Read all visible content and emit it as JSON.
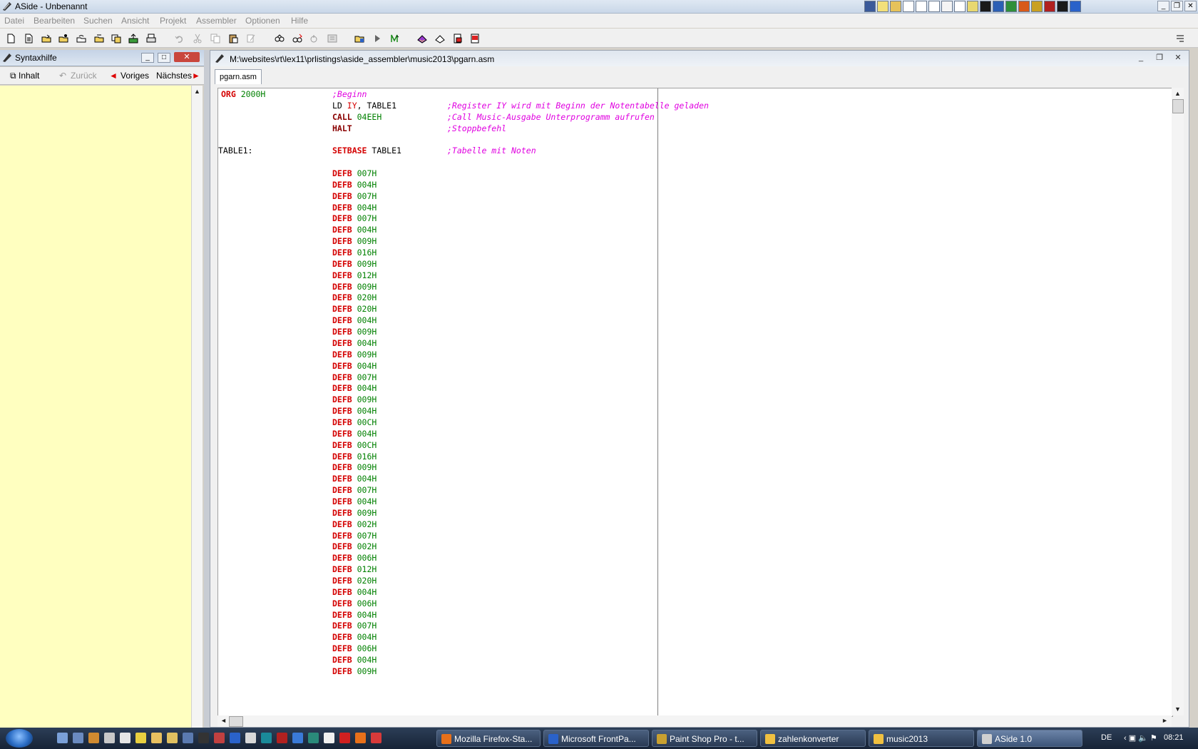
{
  "window": {
    "title": "ASide - Unbenannt"
  },
  "menu": [
    "Datei",
    "Bearbeiten",
    "Suchen",
    "Ansicht",
    "Projekt",
    "Assembler",
    "Optionen",
    "Hilfe"
  ],
  "help_panel": {
    "title": "Syntaxhilfe",
    "nav": {
      "contents": "Inhalt",
      "back": "Zurück",
      "previous": "Voriges",
      "next": "Nächstes"
    }
  },
  "editor": {
    "path": "M:\\websites\\rt\\lex11\\prlistings\\aside_assembler\\music2013\\pgarn.asm",
    "tab": "pgarn.asm",
    "lines": [
      {
        "label": "",
        "kw": "ORG",
        "op": "2000H",
        "comment": ";Beginn",
        "kwcol": 0
      },
      {
        "label": "",
        "kw": "LD",
        "reg": "IY",
        "op": ", TABLE1",
        "comment": ";Register IY wird mit Beginn der Notentabelle geladen"
      },
      {
        "label": "",
        "kw": "CALL",
        "op": "04EEH",
        "comment": ";Call Music-Ausgabe Unterprogramm aufrufen"
      },
      {
        "label": "",
        "kw": "HALT",
        "op": "",
        "comment": ";Stoppbefehl"
      },
      {
        "label": "",
        "kw": "",
        "op": "",
        "comment": ""
      },
      {
        "label": "TABLE1:",
        "kw": "SETBASE",
        "op": "TABLE1",
        "comment": ";Tabelle mit Noten"
      },
      {
        "label": "",
        "kw": "",
        "op": "",
        "comment": ""
      },
      {
        "label": "",
        "kw": "DEFB",
        "op": "007H",
        "comment": ""
      },
      {
        "label": "",
        "kw": "DEFB",
        "op": "004H",
        "comment": ""
      },
      {
        "label": "",
        "kw": "DEFB",
        "op": "007H",
        "comment": ""
      },
      {
        "label": "",
        "kw": "DEFB",
        "op": "004H",
        "comment": ""
      },
      {
        "label": "",
        "kw": "DEFB",
        "op": "007H",
        "comment": ""
      },
      {
        "label": "",
        "kw": "DEFB",
        "op": "004H",
        "comment": ""
      },
      {
        "label": "",
        "kw": "DEFB",
        "op": "009H",
        "comment": ""
      },
      {
        "label": "",
        "kw": "DEFB",
        "op": "016H",
        "comment": ""
      },
      {
        "label": "",
        "kw": "DEFB",
        "op": "009H",
        "comment": ""
      },
      {
        "label": "",
        "kw": "DEFB",
        "op": "012H",
        "comment": ""
      },
      {
        "label": "",
        "kw": "DEFB",
        "op": "009H",
        "comment": ""
      },
      {
        "label": "",
        "kw": "DEFB",
        "op": "020H",
        "comment": ""
      },
      {
        "label": "",
        "kw": "DEFB",
        "op": "020H",
        "comment": ""
      },
      {
        "label": "",
        "kw": "DEFB",
        "op": "004H",
        "comment": ""
      },
      {
        "label": "",
        "kw": "DEFB",
        "op": "009H",
        "comment": ""
      },
      {
        "label": "",
        "kw": "DEFB",
        "op": "004H",
        "comment": ""
      },
      {
        "label": "",
        "kw": "DEFB",
        "op": "009H",
        "comment": ""
      },
      {
        "label": "",
        "kw": "DEFB",
        "op": "004H",
        "comment": ""
      },
      {
        "label": "",
        "kw": "DEFB",
        "op": "007H",
        "comment": ""
      },
      {
        "label": "",
        "kw": "DEFB",
        "op": "004H",
        "comment": ""
      },
      {
        "label": "",
        "kw": "DEFB",
        "op": "009H",
        "comment": ""
      },
      {
        "label": "",
        "kw": "DEFB",
        "op": "004H",
        "comment": ""
      },
      {
        "label": "",
        "kw": "DEFB",
        "op": "00CH",
        "comment": ""
      },
      {
        "label": "",
        "kw": "DEFB",
        "op": "004H",
        "comment": ""
      },
      {
        "label": "",
        "kw": "DEFB",
        "op": "00CH",
        "comment": ""
      },
      {
        "label": "",
        "kw": "DEFB",
        "op": "016H",
        "comment": ""
      },
      {
        "label": "",
        "kw": "DEFB",
        "op": "009H",
        "comment": ""
      },
      {
        "label": "",
        "kw": "DEFB",
        "op": "004H",
        "comment": ""
      },
      {
        "label": "",
        "kw": "DEFB",
        "op": "007H",
        "comment": ""
      },
      {
        "label": "",
        "kw": "DEFB",
        "op": "004H",
        "comment": ""
      },
      {
        "label": "",
        "kw": "DEFB",
        "op": "009H",
        "comment": ""
      },
      {
        "label": "",
        "kw": "DEFB",
        "op": "002H",
        "comment": ""
      },
      {
        "label": "",
        "kw": "DEFB",
        "op": "007H",
        "comment": ""
      },
      {
        "label": "",
        "kw": "DEFB",
        "op": "002H",
        "comment": ""
      },
      {
        "label": "",
        "kw": "DEFB",
        "op": "006H",
        "comment": ""
      },
      {
        "label": "",
        "kw": "DEFB",
        "op": "012H",
        "comment": ""
      },
      {
        "label": "",
        "kw": "DEFB",
        "op": "020H",
        "comment": ""
      },
      {
        "label": "",
        "kw": "DEFB",
        "op": "004H",
        "comment": ""
      },
      {
        "label": "",
        "kw": "DEFB",
        "op": "006H",
        "comment": ""
      },
      {
        "label": "",
        "kw": "DEFB",
        "op": "004H",
        "comment": ""
      },
      {
        "label": "",
        "kw": "DEFB",
        "op": "007H",
        "comment": ""
      },
      {
        "label": "",
        "kw": "DEFB",
        "op": "004H",
        "comment": ""
      },
      {
        "label": "",
        "kw": "DEFB",
        "op": "006H",
        "comment": ""
      },
      {
        "label": "",
        "kw": "DEFB",
        "op": "004H",
        "comment": ""
      },
      {
        "label": "",
        "kw": "DEFB",
        "op": "009H",
        "comment": ""
      }
    ]
  },
  "taskbar": {
    "tasks": [
      {
        "label": "Mozilla Firefox-Sta...",
        "color": "#e8701a"
      },
      {
        "label": "Microsoft FrontPa...",
        "color": "#2a62c9"
      },
      {
        "label": "Paint Shop Pro - t...",
        "color": "#c8a030"
      },
      {
        "label": "zahlenkonverter",
        "color": "#f0c040"
      },
      {
        "label": "music2013",
        "color": "#f0c040"
      },
      {
        "label": "ASide 1.0",
        "color": "#d0d0d0"
      }
    ],
    "language": "DE",
    "clock": "08:21"
  }
}
